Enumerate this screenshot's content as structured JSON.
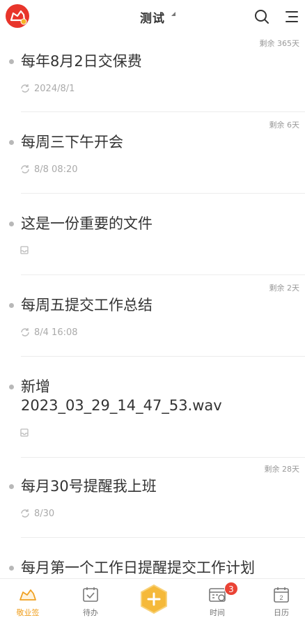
{
  "header": {
    "title": "测试",
    "logo_icon": "app-logo-icon",
    "search_icon": "search-icon",
    "menu_icon": "menu-icon"
  },
  "items": [
    {
      "remaining": "剩余 365天",
      "title": "每年8月2日交保费",
      "meta_icon": "repeat-icon",
      "meta_text": "2024/8/1"
    },
    {
      "remaining": "剩余 6天",
      "title": "每周三下午开会",
      "meta_icon": "repeat-icon",
      "meta_text": "8/8 08:20"
    },
    {
      "remaining": "",
      "title": "这是一份重要的文件",
      "meta_icon": "inbox-icon",
      "meta_text": ""
    },
    {
      "remaining": "剩余 2天",
      "title": "每周五提交工作总结",
      "meta_icon": "repeat-icon",
      "meta_text": "8/4 16:08"
    },
    {
      "remaining": "",
      "title_line1": "新增",
      "title_line2": "2023_03_29_14_47_53.wav",
      "meta_icon": "inbox-icon",
      "meta_text": ""
    },
    {
      "remaining": "剩余 28天",
      "title": "每月30号提醒我上班",
      "meta_icon": "repeat-icon",
      "meta_text": "8/30"
    },
    {
      "remaining": "",
      "title": "每月第一个工作日提醒提交工作计划",
      "meta_icon": "",
      "meta_text": ""
    }
  ],
  "tabbar": {
    "tabs": [
      {
        "label": "敬业签",
        "icon": "note-icon",
        "active": true
      },
      {
        "label": "待办",
        "icon": "todo-icon",
        "active": false
      },
      {
        "label": "",
        "icon": "add-icon",
        "active": false
      },
      {
        "label": "时间",
        "icon": "timeline-icon",
        "active": false,
        "badge": "3"
      },
      {
        "label": "日历",
        "icon": "calendar-icon",
        "active": false,
        "day": "2"
      }
    ]
  },
  "colors": {
    "accent": "#f0a020",
    "brand_red": "#e8352b",
    "badge": "#ea4335"
  }
}
